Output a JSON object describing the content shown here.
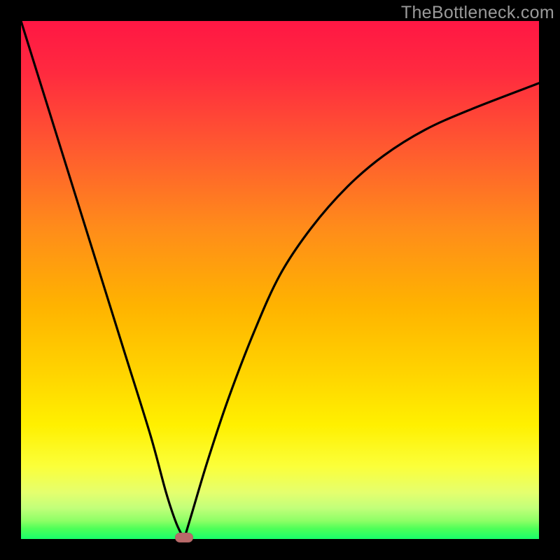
{
  "watermark": "TheBottleneck.com",
  "chart_data": {
    "type": "line",
    "title": "",
    "xlabel": "",
    "ylabel": "",
    "xlim": [
      0,
      100
    ],
    "ylim": [
      0,
      100
    ],
    "grid": false,
    "legend": false,
    "series": [
      {
        "name": "left-branch",
        "x": [
          0,
          5,
          10,
          15,
          20,
          25,
          28,
          30,
          31.5
        ],
        "values": [
          100,
          84,
          68,
          52,
          36,
          20,
          9,
          3,
          0
        ]
      },
      {
        "name": "right-branch",
        "x": [
          31.5,
          33,
          36,
          40,
          45,
          50,
          56,
          63,
          70,
          78,
          87,
          100
        ],
        "values": [
          0,
          5,
          15,
          27,
          40,
          51,
          60,
          68,
          74,
          79,
          83,
          88
        ]
      }
    ],
    "annotations": [
      {
        "name": "min-marker",
        "x": 31.5,
        "y": 0,
        "color": "#b96a6a"
      }
    ],
    "background_gradient": {
      "top": "#ff1744",
      "mid": "#ffd400",
      "bottom": "#18ff6a"
    }
  }
}
